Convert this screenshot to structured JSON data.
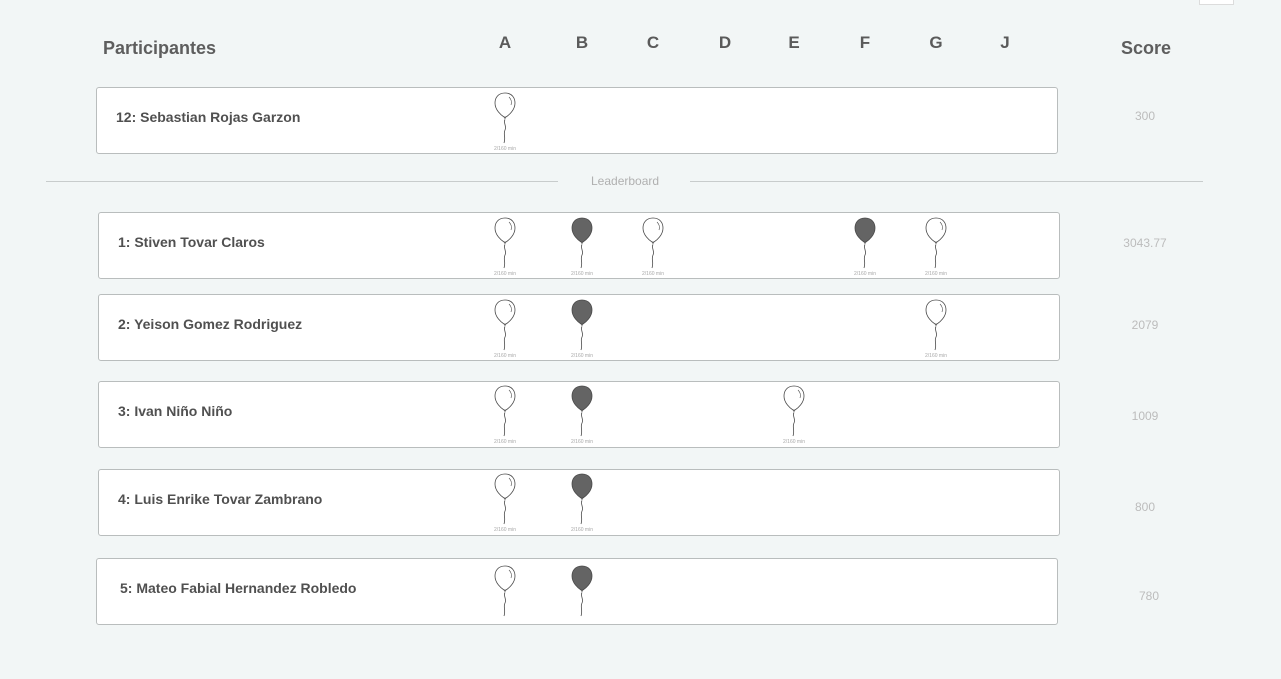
{
  "header": {
    "participants_label": "Participantes",
    "score_label": "Score",
    "problems": [
      "A",
      "B",
      "C",
      "D",
      "E",
      "F",
      "G",
      "J"
    ]
  },
  "colors": {
    "solved": "#646464",
    "first_to_solve": "#ffffff",
    "outline": "#4a4a4a"
  },
  "current_user": {
    "label": "12:  Sebastian Rojas Garzon",
    "score": "300",
    "balloons": [
      {
        "problem": "A",
        "fill": "white",
        "time": "2/160 min"
      }
    ]
  },
  "leaderboard_label": "Leaderboard",
  "leaderboard": [
    {
      "label": "1: Stiven Tovar Claros",
      "score": "3043.77",
      "balloons": [
        {
          "problem": "A",
          "fill": "white",
          "time": "2/160 min"
        },
        {
          "problem": "B",
          "fill": "dark",
          "time": "2/160 min"
        },
        {
          "problem": "C",
          "fill": "white",
          "time": "2/160 min"
        },
        {
          "problem": "F",
          "fill": "dark",
          "time": "2/160 min"
        },
        {
          "problem": "G",
          "fill": "white",
          "time": "2/160 min"
        }
      ]
    },
    {
      "label": "2: Yeison Gomez Rodriguez",
      "score": "2079",
      "balloons": [
        {
          "problem": "A",
          "fill": "white",
          "time": "2/160 min"
        },
        {
          "problem": "B",
          "fill": "dark",
          "time": "2/160 min"
        },
        {
          "problem": "G",
          "fill": "white",
          "time": "2/160 min"
        }
      ]
    },
    {
      "label": "3: Ivan Niño Niño",
      "score": "1009",
      "balloons": [
        {
          "problem": "A",
          "fill": "white",
          "time": "2/160 min"
        },
        {
          "problem": "B",
          "fill": "dark",
          "time": "2/160 min"
        },
        {
          "problem": "E",
          "fill": "white",
          "time": "2/160 min"
        }
      ]
    },
    {
      "label": "4:  Luis Enrike Tovar Zambrano",
      "score": "800",
      "balloons": [
        {
          "problem": "A",
          "fill": "white",
          "time": "2/160 min"
        },
        {
          "problem": "B",
          "fill": "dark",
          "time": "2/160 min"
        }
      ]
    },
    {
      "label": "5:  Mateo Fabial Hernandez Robledo",
      "score": "780",
      "balloons": [
        {
          "problem": "A",
          "fill": "white",
          "time": ""
        },
        {
          "problem": "B",
          "fill": "dark",
          "time": ""
        }
      ]
    }
  ]
}
